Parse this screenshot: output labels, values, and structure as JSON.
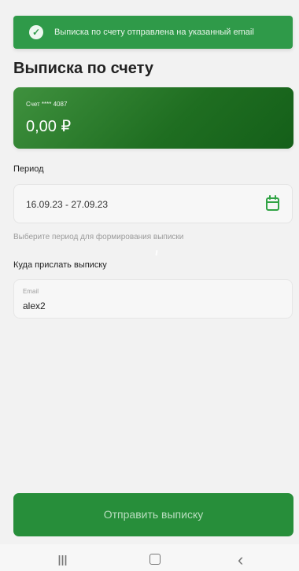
{
  "toast": {
    "icon": "check-circle-icon",
    "message": "Выписка по счету отправлена на указанный email"
  },
  "page": {
    "title": "Выписка по счету"
  },
  "account_card": {
    "account_number": "Счет **** 4087",
    "balance": "0,00 ₽"
  },
  "period": {
    "label": "Период",
    "value": "16.09.23 - 27.09.23",
    "icon": "calendar-icon",
    "helper_text": "Выберите период для формирования выписки"
  },
  "email_section": {
    "label": "Куда прислать выписку",
    "field_label": "Email",
    "value": "alex2"
  },
  "actions": {
    "send_label": "Отправить выписку"
  },
  "system_nav": {
    "recents_icon": "recents-icon",
    "home_icon": "home-icon",
    "back_icon": "back-icon"
  },
  "colors": {
    "accent": "#278e3a",
    "toast": "#2f9a49",
    "card_dark": "#145f19"
  }
}
